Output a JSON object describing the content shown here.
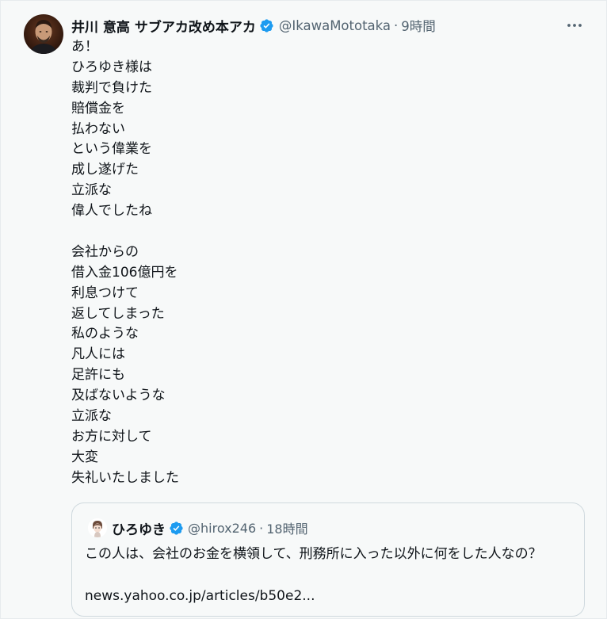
{
  "tweet": {
    "display_name": "井川 意高 サブアカ改め本アカ",
    "handle": "@IkawaMototaka",
    "separator": "·",
    "time": "9時間",
    "avatar_icon": "user-avatar-icon",
    "verified_icon": "verified-badge-icon",
    "more_icon": "more-options-icon",
    "verified_color": "#1d9bf0",
    "lines_1": [
      "あ！",
      "ひろゆき様は",
      "裁判で負けた",
      "賠償金を",
      "払わない",
      "という偉業を",
      "成し遂げた",
      "立派な",
      "偉人でしたね"
    ],
    "lines_2": [
      "会社からの",
      "借入金106億円を",
      "利息つけて",
      "返してしまった",
      "私のような",
      "凡人には",
      "足許にも",
      "及ばないような",
      "立派な",
      "お方に対して",
      "大変",
      "失礼いたしました"
    ]
  },
  "quote": {
    "display_name": "ひろゆき",
    "handle": "@hirox246",
    "separator": "·",
    "time": "18時間",
    "avatar_icon": "quoted-user-avatar-icon",
    "verified_icon": "verified-badge-icon",
    "text": "この人は、会社のお金を横領して、刑務所に入った以外に何をした人なの？",
    "link": "news.yahoo.co.jp/articles/b50e2..."
  },
  "colors": {
    "text_primary": "#0f1419",
    "text_secondary": "#536471",
    "background": "#f7f9f9",
    "border": "#cfd9de",
    "verified_blue": "#1d9bf0"
  }
}
